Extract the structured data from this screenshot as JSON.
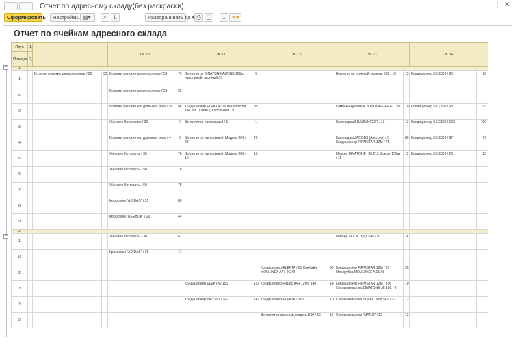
{
  "window": {
    "title": "Отчет по адресному складу(без раскраски)",
    "back_label": "←",
    "forward_label": "→",
    "more_label": "⋮",
    "close_label": "✕"
  },
  "toolbar": {
    "generate_label": "Сформировать",
    "settings_label": "Настройки...",
    "expand_label": "Разворачивать до"
  },
  "report": {
    "title": "Отчет по ячейкам адресного склада",
    "col_tier": "Ярус",
    "col_position": "Позиция",
    "columns": [
      "1",
      "ОСТЗ",
      "ЭСТ1",
      "ЭСТ2",
      "ЭСТ3",
      "ЭСТ4"
    ],
    "groups": [
      {
        "label": "1",
        "rows": [
          {
            "pos": "1",
            "cells": [
              {
                "name": "Ботинки женские демисезонные / 25",
                "qty": "35"
              },
              {
                "name": "Ботинки женские демисезонные / 59",
                "qty": "79"
              },
              {
                "name": "Вентилятор BINATONE ALPINE 160вт, напольный, оконный / 5",
                "qty": "5"
              },
              {
                "name": "",
                "qty": ""
              },
              {
                "name": "Вентилятор оконный, модель 502 / 15",
                "qty": "15"
              },
              {
                "name": "Кондиционер БК-2300 / 90",
                "qty": "90"
              }
            ]
          },
          {
            "pos": "10",
            "cells": [
              {
                "name": "",
                "qty": ""
              },
              {
                "name": "Ботинки женские демисезонные / 59",
                "qty": "92"
              },
              {
                "name": "",
                "qty": ""
              },
              {
                "name": "",
                "qty": ""
              },
              {
                "name": "",
                "qty": ""
              },
              {
                "name": "",
                "qty": ""
              }
            ]
          },
          {
            "pos": "2",
            "cells": [
              {
                "name": "",
                "qty": ""
              },
              {
                "name": "Ботинки женские натуральная кожа / 55",
                "qty": "86"
              },
              {
                "name": "Кондиционер ELEKTA / 79 Вентилятор JIPONIC (Тайв.), напольный / 9",
                "qty": "88"
              },
              {
                "name": "",
                "qty": ""
              },
              {
                "name": "Комбайн кухонный BINATONE FP 67 / 10",
                "qty": "10"
              },
              {
                "name": "Кондиционер БК-2300 / 93",
                "qty": "93"
              }
            ]
          },
          {
            "pos": "3",
            "cells": [
              {
                "name": "",
                "qty": ""
              },
              {
                "name": "Женские босоножки / 30",
                "qty": "47"
              },
              {
                "name": "Вентилятор настольный / 1",
                "qty": "1"
              },
              {
                "name": "",
                "qty": ""
              },
              {
                "name": "Кофеварка BRAUN KF22R / 13",
                "qty": "13"
              },
              {
                "name": "Кондиционер БК-2300 / 100",
                "qty": "100"
              }
            ]
          },
          {
            "pos": "4",
            "cells": [
              {
                "name": "",
                "qty": ""
              },
              {
                "name": "Ботинки женские натуральная кожа / 4",
                "qty": "6"
              },
              {
                "name": "Вентилятор настольный, Модель 801 / 23",
                "qty": "23"
              },
              {
                "name": "",
                "qty": ""
              },
              {
                "name": "Кофеварка JACOBS (Австрия) / 5 Кондиционер FIRMSTAR 12М / 75",
                "qty": "80"
              },
              {
                "name": "Кондиционер БК-2300 / 97",
                "qty": "97"
              }
            ]
          },
          {
            "pos": "5",
            "cells": [
              {
                "name": "",
                "qty": ""
              },
              {
                "name": "Женские ботфорты / 55",
                "qty": "78"
              },
              {
                "name": "Вентилятор настольный, Модель 802 / 15",
                "qty": "15"
              },
              {
                "name": "",
                "qty": ""
              },
              {
                "name": "Миксер BINATONE HM 212,6 скор. 150вт / 11",
                "qty": "11"
              },
              {
                "name": "Кондиционер БК-2300 / 23",
                "qty": "23"
              }
            ]
          },
          {
            "pos": "6",
            "cells": [
              {
                "name": "",
                "qty": ""
              },
              {
                "name": "Женские ботфорты / 50",
                "qty": "78"
              },
              {
                "name": "",
                "qty": ""
              },
              {
                "name": "",
                "qty": ""
              },
              {
                "name": "",
                "qty": ""
              },
              {
                "name": "",
                "qty": ""
              }
            ]
          },
          {
            "pos": "7",
            "cells": [
              {
                "name": "",
                "qty": ""
              },
              {
                "name": "Женские ботфорты / 50",
                "qty": "78"
              },
              {
                "name": "",
                "qty": ""
              },
              {
                "name": "",
                "qty": ""
              },
              {
                "name": "",
                "qty": ""
              },
              {
                "name": "",
                "qty": ""
              }
            ]
          },
          {
            "pos": "8",
            "cells": [
              {
                "name": "",
                "qty": ""
              },
              {
                "name": "Кроссовки \"ADIDAS\" / 51",
                "qty": "80"
              },
              {
                "name": "",
                "qty": ""
              },
              {
                "name": "",
                "qty": ""
              },
              {
                "name": "",
                "qty": ""
              },
              {
                "name": "",
                "qty": ""
              }
            ]
          },
          {
            "pos": "9",
            "cells": [
              {
                "name": "",
                "qty": ""
              },
              {
                "name": "Кроссовки \"REEBOK\" / 20",
                "qty": "44"
              },
              {
                "name": "",
                "qty": ""
              },
              {
                "name": "",
                "qty": ""
              },
              {
                "name": "",
                "qty": ""
              },
              {
                "name": "",
                "qty": ""
              }
            ]
          }
        ]
      },
      {
        "label": "2",
        "rows": [
          {
            "pos": "1",
            "cells": [
              {
                "name": "",
                "qty": ""
              },
              {
                "name": "Женские ботфорты / 30",
                "qty": "47"
              },
              {
                "name": "",
                "qty": ""
              },
              {
                "name": "",
                "qty": ""
              },
              {
                "name": "Миксер SOLAC мод.545 / 9",
                "qty": "9"
              },
              {
                "name": "",
                "qty": ""
              }
            ]
          },
          {
            "pos": "10",
            "cells": [
              {
                "name": "",
                "qty": ""
              },
              {
                "name": "Кроссовки \"ADIDAS\" / 11",
                "qty": "17"
              },
              {
                "name": "",
                "qty": ""
              },
              {
                "name": "",
                "qty": ""
              },
              {
                "name": "",
                "qty": ""
              },
              {
                "name": "",
                "qty": ""
              }
            ]
          },
          {
            "pos": "2",
            "cells": [
              {
                "name": "",
                "qty": ""
              },
              {
                "name": "",
                "qty": ""
              },
              {
                "name": "",
                "qty": ""
              },
              {
                "name": "Кондиционер ELEKTA / 85 Комбайн MOULINEX A77 4С / 5",
                "qty": "90"
              },
              {
                "name": "Кондиционер FIRMSTAR 12М / 87 Мясорубка MOULINEX A 15 / 8",
                "qty": "95"
              },
              {
                "name": "",
                "qty": ""
              }
            ]
          },
          {
            "pos": "3",
            "cells": [
              {
                "name": "",
                "qty": ""
              },
              {
                "name": "",
                "qty": ""
              },
              {
                "name": "Кондиционер ELEKTA / 151",
                "qty": "151"
              },
              {
                "name": "Кондиционер FIRMSTAR 12М / 140",
                "qty": "140"
              },
              {
                "name": "Кондиционер FIRMSTAR 12М / 106 Соковыжималка BINATONE JE 102 / 9",
                "qty": "109"
              },
              {
                "name": "",
                "qty": ""
              }
            ]
          },
          {
            "pos": "4",
            "cells": [
              {
                "name": "",
                "qty": ""
              },
              {
                "name": "",
                "qty": ""
              },
              {
                "name": "Кондиционер БК-2300 / 142",
                "qty": "142"
              },
              {
                "name": "Кондиционер ELEKTA / 100",
                "qty": "100"
              },
              {
                "name": "Соковыжималка SOLAC Мод.541 / 12",
                "qty": "12"
              },
              {
                "name": "",
                "qty": ""
              }
            ]
          },
          {
            "pos": "5",
            "cells": [
              {
                "name": "",
                "qty": ""
              },
              {
                "name": "",
                "qty": ""
              },
              {
                "name": "",
                "qty": ""
              },
              {
                "name": "Вентилятор оконный, модель 500 / 16",
                "qty": "16"
              },
              {
                "name": "Соковыжималка \"MAGO\" / 12",
                "qty": "12"
              },
              {
                "name": "",
                "qty": ""
              }
            ]
          }
        ]
      }
    ]
  },
  "colors": {
    "primary_button": "#f9d64a",
    "header_bg": "#f2ebc4",
    "group_bg": "#f4eecd"
  }
}
